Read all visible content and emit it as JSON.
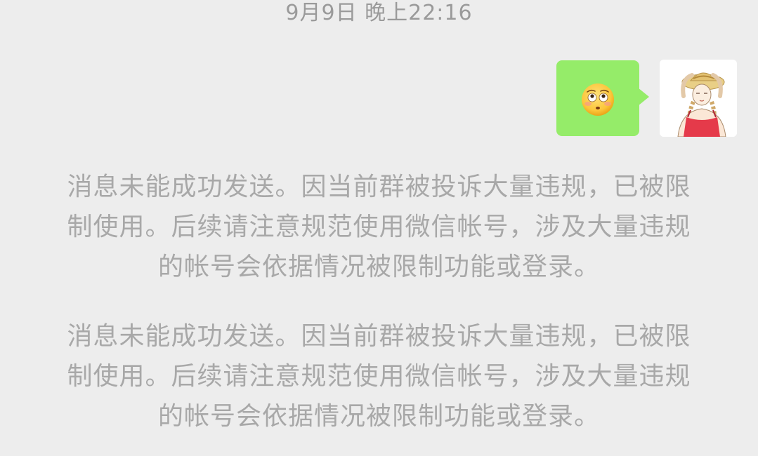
{
  "chat": {
    "timestamp": "9月9日 晚上22:16"
  },
  "message": {
    "sender": "self",
    "content_emoji": "flushed-face"
  },
  "system_notices": [
    {
      "lines": [
        "消息未能成功发送。因当前群被投诉大量违规，已被限",
        "制使用。后续请注意规范使用微信帐号，涉及大量违规",
        "的帐号会依据情况被限制功能或登录。"
      ]
    },
    {
      "lines": [
        "消息未能成功发送。因当前群被投诉大量违规，已被限",
        "制使用。后续请注意规范使用微信帐号，涉及大量违规",
        "的帐号会依据情况被限制功能或登录。"
      ]
    }
  ],
  "colors": {
    "background": "#ededed",
    "bubble_green": "#95ec69",
    "system_text": "#a8a8a8",
    "timestamp_text": "#9a9a9a"
  }
}
